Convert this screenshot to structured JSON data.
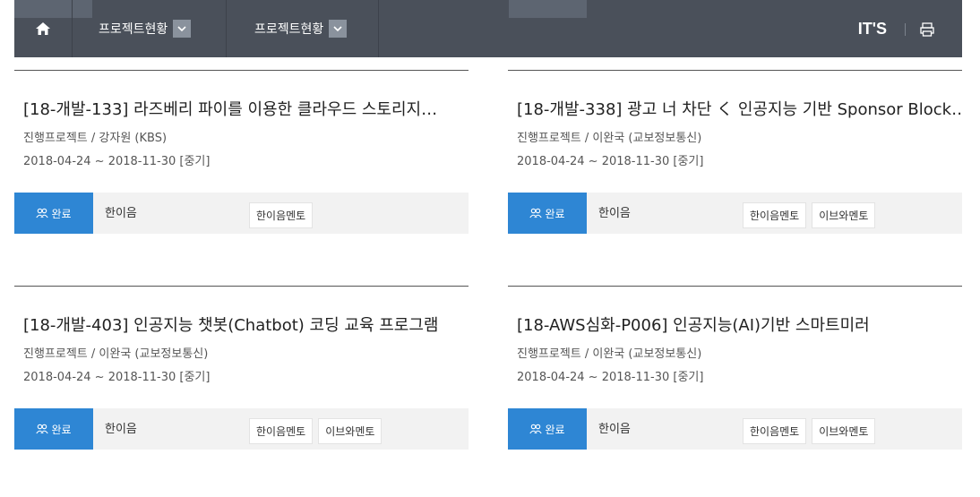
{
  "header": {
    "breadcrumb": [
      {
        "label": "프로젝트현황"
      },
      {
        "label": "프로젝트현황"
      }
    ],
    "brand": "IT'S",
    "icons": [
      "home-icon",
      "chevron-down-icon",
      "printer-icon"
    ]
  },
  "cards": [
    {
      "title": "[18-개발-133] 라즈베리 파이를 이용한 클라우드 스토리지…",
      "meta": "진행프로젝트 / 강자원 (KBS)",
      "date": "2018-04-24 ~ 2018-11-30 [중기]",
      "status": "완료",
      "team": "한이음",
      "mentors": [
        "한이음멘토"
      ]
    },
    {
      "title": "[18-개발-338] 광고 너 차단 く 인공지능 기반 Sponsor Block…",
      "meta": "진행프로젝트 / 이완국 (교보정보통신)",
      "date": "2018-04-24 ~ 2018-11-30 [중기]",
      "status": "완료",
      "team": "한이음",
      "mentors": [
        "한이음멘토",
        "이브와멘토"
      ]
    },
    {
      "title": "[18-개발-403] 인공지능 챗봇(Chatbot) 코딩 교육 프로그램",
      "meta": "진행프로젝트 / 이완국 (교보정보통신)",
      "date": "2018-04-24 ~ 2018-11-30 [중기]",
      "status": "완료",
      "team": "한이음",
      "mentors": [
        "한이음멘토",
        "이브와멘토"
      ]
    },
    {
      "title": "[18-AWS심화-P006] 인공지능(AI)기반 스마트미러",
      "meta": "진행프로젝트 / 이완국 (교보정보통신)",
      "date": "2018-04-24 ~ 2018-11-30 [중기]",
      "status": "완료",
      "team": "한이음",
      "mentors": [
        "한이음멘토",
        "이브와멘토"
      ]
    }
  ],
  "colors": {
    "topbar": "#4a505a",
    "status_badge": "#2e86d4",
    "card_bar": "#f2f2f2"
  }
}
